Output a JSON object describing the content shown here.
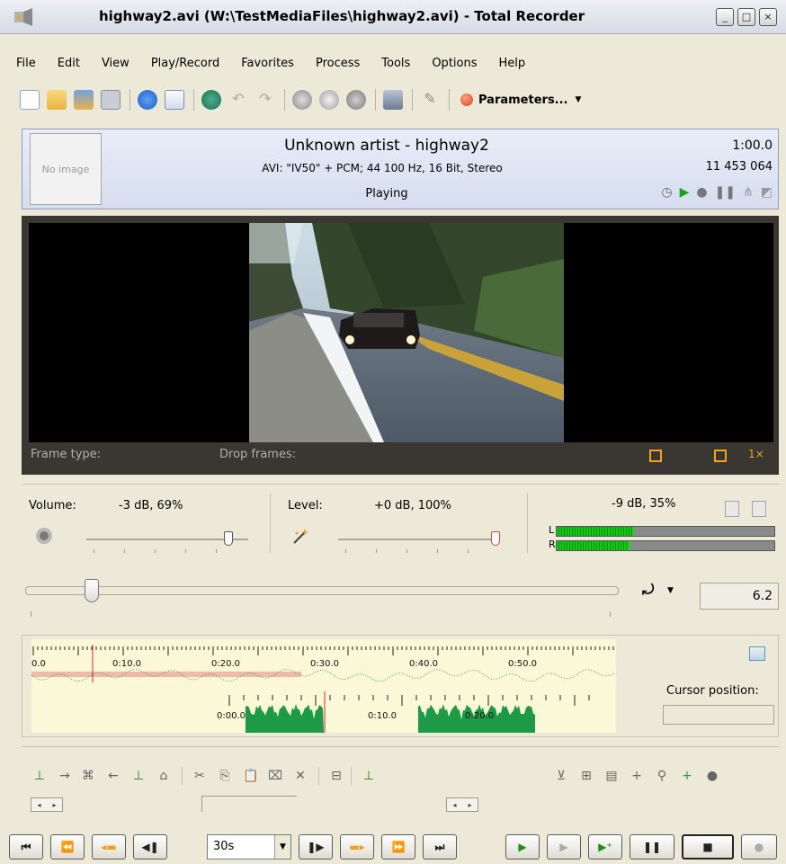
{
  "window": {
    "title": "highway2.avi (W:\\TestMediaFiles\\highway2.avi) - Total Recorder",
    "controls": [
      "minimize-icon",
      "maximize-icon",
      "close-icon"
    ]
  },
  "menu": [
    "File",
    "Edit",
    "View",
    "Play/Record",
    "Favorites",
    "Process",
    "Tools",
    "Options",
    "Help"
  ],
  "toolbar": {
    "parameters_label": "Parameters...",
    "icons": [
      "new-icon",
      "open-icon",
      "open-folder-icon",
      "save-icon",
      "info-icon",
      "edit-tags-icon",
      "refresh-icon",
      "undo-icon",
      "redo-icon",
      "record-settings-icon",
      "scheduler-icon",
      "stop-icon",
      "settings-icon",
      "tools-icon"
    ]
  },
  "info": {
    "no_image": "No image",
    "artist_title": "Unknown artist - highway2",
    "format": "AVI: \"IV50\" + PCM; 44 100 Hz, 16 Bit, Stereo",
    "status": "Playing",
    "duration": "1:00.0",
    "size": "11 453 064"
  },
  "video": {
    "frame_type_label": "Frame type:",
    "drop_frames_label": "Drop frames:",
    "zoom_label": "1×"
  },
  "volume": {
    "volume_label": "Volume:",
    "volume_value": "-3 dB, 69%",
    "volume_level": 0.69,
    "level_label": "Level:",
    "level_value": "+0 dB, 100%",
    "level_level": 1.0,
    "meter_value": "-9 dB, 35%",
    "meter_left_label": "L",
    "meter_right_label": "R",
    "meter_fill": 0.35
  },
  "position": {
    "speed_value": "6.2"
  },
  "waveform": {
    "top_ticks": [
      "0.0",
      "0:10.0",
      "0:20.0",
      "0:30.0",
      "0:40.0",
      "0:50.0"
    ],
    "bottom_ticks": [
      "0:00.0",
      "0:10.0",
      "0:20.0"
    ],
    "cursor_position_label": "Cursor position:",
    "cursor_position_value": ""
  },
  "transport": {
    "interval_value": "30s"
  }
}
